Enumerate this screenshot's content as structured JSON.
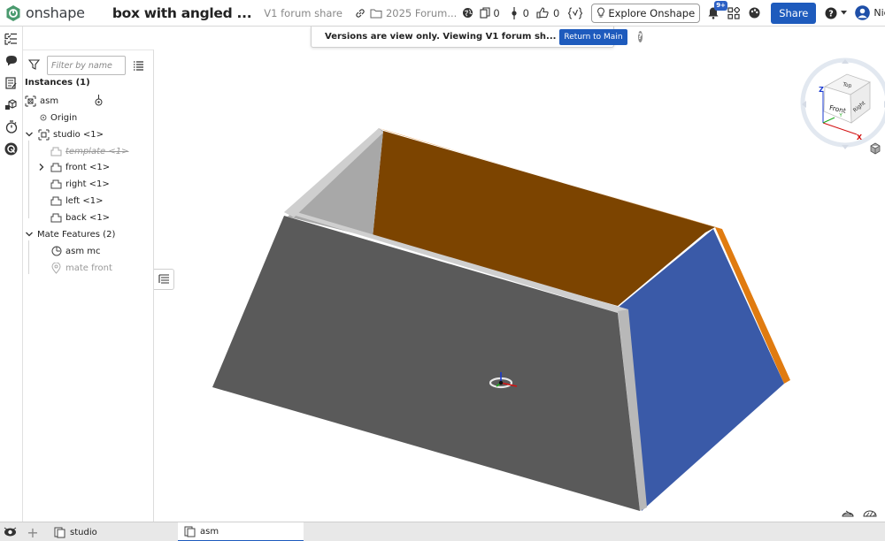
{
  "app": {
    "logo_text": "onshape"
  },
  "document": {
    "title": "box with angled ...",
    "version": "V1 forum share",
    "folder": "2025 Forum...",
    "branches_count": "0",
    "versions_count": "0",
    "likes_count": "0"
  },
  "toolbar": {
    "explore_label": "Explore Onshape",
    "notifications_badge": "9+",
    "share_label": "Share",
    "user_name": "Nick Papageorge (Persona"
  },
  "banner": {
    "text": "Versions are view only. Viewing V1 forum sh...",
    "button_label": "Return to Main"
  },
  "panel": {
    "filter_placeholder": "Filter by name",
    "instances_label": "Instances (1)",
    "tree": {
      "asm": "asm",
      "origin": "Origin",
      "studio": "studio <1>",
      "template": "template <1>",
      "front": "front <1>",
      "right": "right <1>",
      "left": "left <1>",
      "back": "back <1>",
      "mate_features": "Mate Features (2)",
      "asm_mc": "asm mc",
      "mate_front": "mate front"
    }
  },
  "viewcube": {
    "top": "Top",
    "front": "Front",
    "right": "Right",
    "axis_x": "X",
    "axis_y": "Y",
    "axis_z": "Z"
  },
  "model_colors": {
    "front_face": "#5a5a5a",
    "back_inner": "#7c4400",
    "right_face": "#3a5aa8",
    "left_inner": "#a8a8a8",
    "edge_highlight": "#e07b10"
  },
  "tabs": [
    {
      "label": "studio"
    },
    {
      "label": "asm"
    }
  ],
  "colors": {
    "accent": "#1e5bbd"
  }
}
